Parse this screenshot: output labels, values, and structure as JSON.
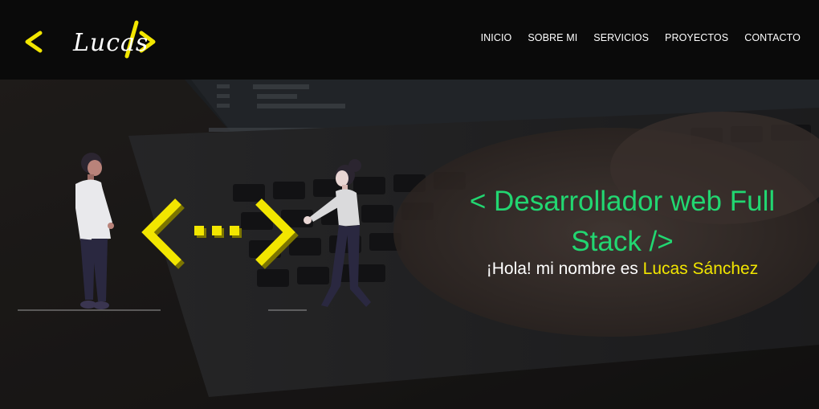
{
  "header": {
    "logo_text": "Lucas",
    "nav": [
      {
        "label": "INICIO"
      },
      {
        "label": "SOBRE MI"
      },
      {
        "label": "SERVICIOS"
      },
      {
        "label": "PROYECTOS"
      },
      {
        "label": "CONTACTO"
      }
    ]
  },
  "hero": {
    "headline": "< Desarrollador web Full Stack />",
    "greeting_prefix": "¡Hola! mi nombre es ",
    "greeting_name": "Lucas Sánchez",
    "illustration_icon": "two-people-code-brackets-illustration",
    "background_icon": "laptop-typing-photo"
  },
  "colors": {
    "accent_yellow": "#f2e600",
    "accent_green": "#22d671",
    "navbar_bg": "#0a0a0a",
    "text_white": "#ffffff"
  }
}
